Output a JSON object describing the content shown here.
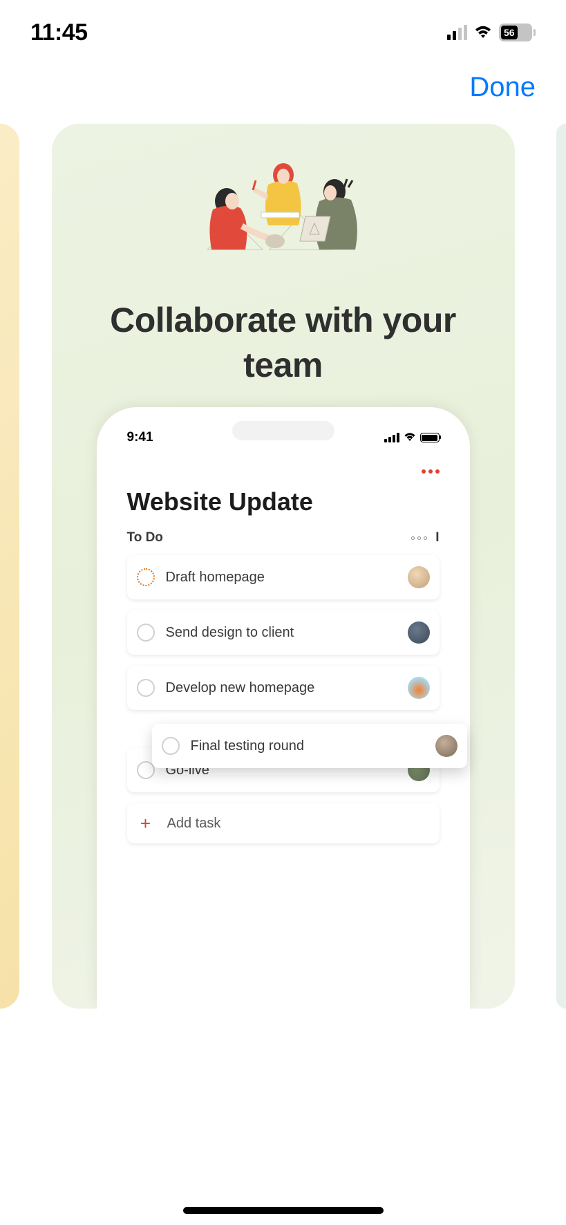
{
  "statusBar": {
    "time": "11:45",
    "battery": "56"
  },
  "header": {
    "doneLabel": "Done"
  },
  "card": {
    "heading": "Collaborate with your team"
  },
  "phone": {
    "time": "9:41",
    "projectTitle": "Website Update",
    "columnTitle": "To Do",
    "nextColumnPeek": "I",
    "tasks": [
      {
        "label": "Draft homepage",
        "avatarColor": "#d4b896"
      },
      {
        "label": "Send design to client",
        "avatarColor": "#5a6b7a"
      },
      {
        "label": "Develop new homepage",
        "avatarColor": "#e8720c"
      }
    ],
    "floatingTask": {
      "label": "Final testing round",
      "avatarColor": "#8a7a6a"
    },
    "partialTask": {
      "label": "Go-live",
      "avatarColor": "#7a8a6a"
    },
    "addTaskLabel": "Add task"
  }
}
